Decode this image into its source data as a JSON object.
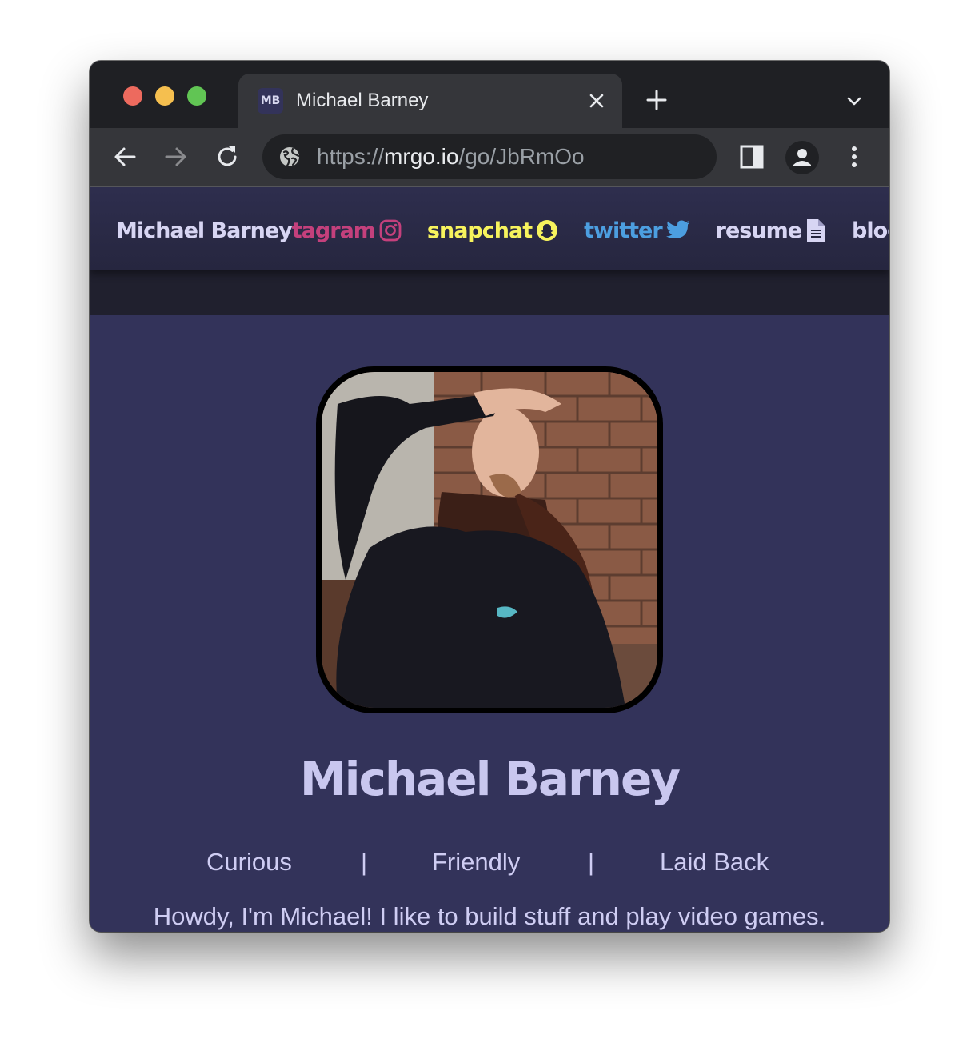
{
  "browser": {
    "tab": {
      "favicon_text": "MB",
      "title": "Michael Barney"
    },
    "omnibox": {
      "scheme": "https://",
      "host": "mrgo.io",
      "path": "/go/JbRmOo"
    },
    "icons": [
      "back-arrow-icon",
      "forward-arrow-icon",
      "reload-icon",
      "globe-icon",
      "side-panel-icon",
      "profile-icon",
      "kebab-menu-icon",
      "close-icon",
      "plus-icon",
      "chevron-down-icon"
    ]
  },
  "nav": {
    "brand": "Michael Barney",
    "links": [
      {
        "label": "tagram",
        "icon": "instagram-icon",
        "color": "#c4407c"
      },
      {
        "label": "snapchat",
        "icon": "snapchat-icon",
        "color": "#f7f35d"
      },
      {
        "label": "twitter",
        "icon": "twitter-icon",
        "color": "#4c9ee0"
      },
      {
        "label": "resume",
        "icon": "document-icon",
        "color": "#d7d5f3"
      },
      {
        "label": "blog",
        "icon": "rss-icon",
        "color": "#d7d5f3"
      }
    ]
  },
  "profile": {
    "photo_alt": "Michael Barney",
    "name": "Michael Barney",
    "traits": [
      "Curious",
      "|",
      "Friendly",
      "|",
      "Laid Back"
    ],
    "intro": "Howdy, I'm Michael! I like to build stuff and play video games."
  },
  "colors": {
    "page_bg": "#33335a",
    "navbar_bg": "#2a2a46",
    "text": "#cfcdf3",
    "accent_instagram": "#c4407c",
    "accent_snapchat": "#f7f35d",
    "accent_twitter": "#4c9ee0"
  }
}
